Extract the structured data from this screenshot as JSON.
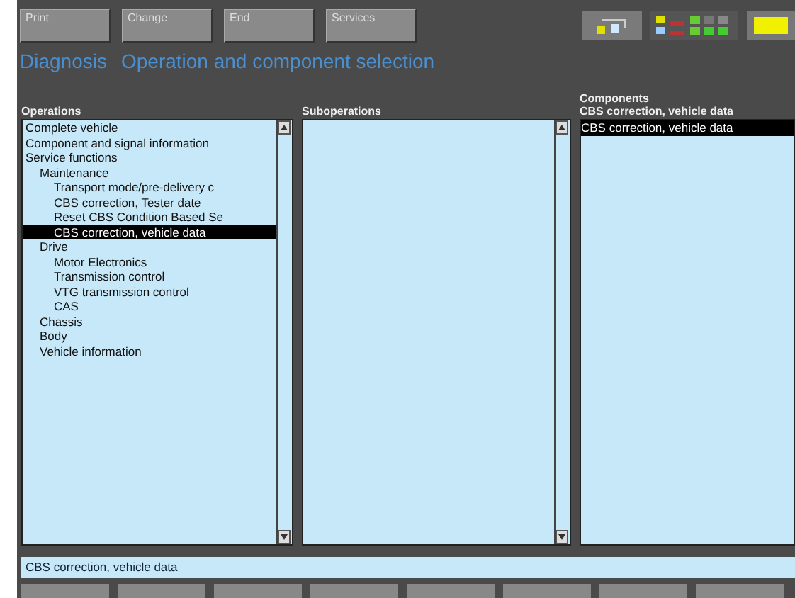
{
  "toolbar": {
    "buttons": [
      "Print",
      "Change",
      "End",
      "Services"
    ]
  },
  "title": {
    "area": "Diagnosis",
    "text": "Operation and component selection"
  },
  "operations": {
    "heading": "Operations",
    "items": [
      {
        "label": "Complete vehicle",
        "selected": false
      },
      {
        "label": "Component and signal information",
        "selected": false
      },
      {
        "label": "Service functions",
        "selected": false,
        "children": [
          {
            "label": "Maintenance",
            "selected": false,
            "children": [
              {
                "label": "Transport mode/pre-delivery c",
                "selected": false
              },
              {
                "label": "CBS correction, Tester date",
                "selected": false
              },
              {
                "label": "Reset CBS Condition Based Se",
                "selected": false
              },
              {
                "label": "CBS correction, vehicle data",
                "selected": true
              }
            ]
          },
          {
            "label": "Drive",
            "selected": false,
            "children": [
              {
                "label": "Motor Electronics",
                "selected": false
              },
              {
                "label": "Transmission control",
                "selected": false
              },
              {
                "label": "VTG transmission control",
                "selected": false
              },
              {
                "label": "CAS",
                "selected": false
              }
            ]
          },
          {
            "label": "Chassis",
            "selected": false
          },
          {
            "label": "Body",
            "selected": false
          },
          {
            "label": "Vehicle information",
            "selected": false
          }
        ]
      }
    ]
  },
  "suboperations": {
    "heading": "Suboperations"
  },
  "components": {
    "heading": "Components",
    "subheading": "CBS correction, vehicle data",
    "items": [
      {
        "label": "CBS correction, vehicle data",
        "selected": true
      }
    ]
  },
  "status_bar": "CBS correction, vehicle data"
}
